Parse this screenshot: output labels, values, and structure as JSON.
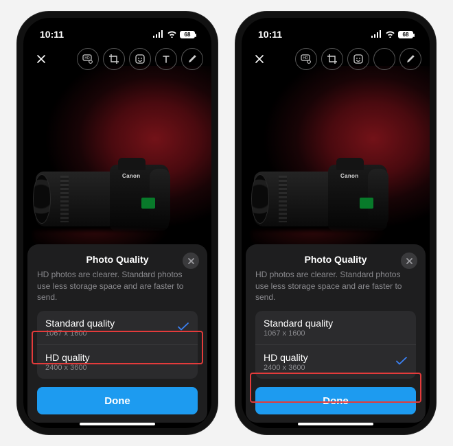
{
  "status": {
    "time": "10:11",
    "battery": "68"
  },
  "toolbar": {
    "icons": [
      "hd-settings",
      "crop",
      "sticker",
      "text",
      "draw"
    ]
  },
  "photo": {
    "brand": "Canon"
  },
  "sheet": {
    "title": "Photo Quality",
    "desc": "HD photos are clearer. Standard photos use less storage space and are faster to send.",
    "options": [
      {
        "label": "Standard quality",
        "res": "1067 x 1600"
      },
      {
        "label": "HD quality",
        "res": "2400 x 3600"
      }
    ],
    "done": "Done"
  },
  "screens": [
    {
      "selected": 0,
      "highlight": "hd"
    },
    {
      "selected": 1,
      "highlight": "done"
    }
  ]
}
